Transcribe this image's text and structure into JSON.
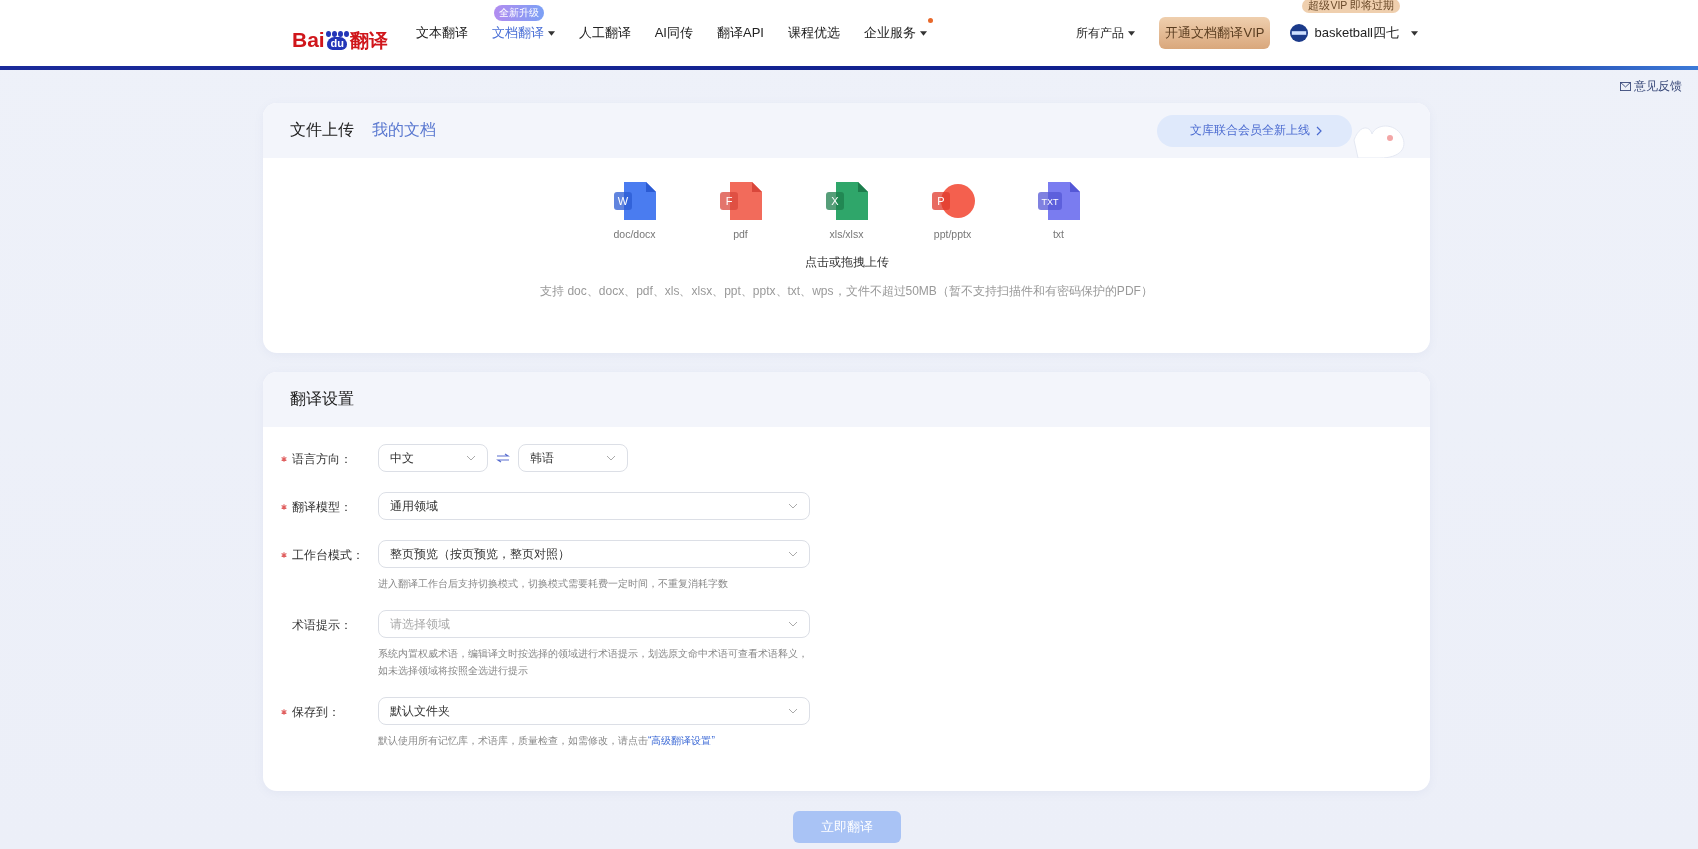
{
  "header": {
    "logo": {
      "latin": "Bai",
      "paw": "du",
      "cn": "翻译"
    },
    "nav": [
      {
        "label": "文本翻译",
        "selected": false,
        "has_menu": false,
        "has_dot": false
      },
      {
        "label": "文档翻译",
        "selected": true,
        "has_menu": true,
        "has_dot": false,
        "badge": "全新升级"
      },
      {
        "label": "人工翻译",
        "selected": false,
        "has_menu": false,
        "has_dot": false
      },
      {
        "label": "AI同传",
        "selected": false,
        "has_menu": false,
        "has_dot": false
      },
      {
        "label": "翻译API",
        "selected": false,
        "has_menu": false,
        "has_dot": false
      },
      {
        "label": "课程优选",
        "selected": false,
        "has_menu": false,
        "has_dot": false
      },
      {
        "label": "企业服务",
        "selected": false,
        "has_menu": true,
        "has_dot": true
      }
    ],
    "products": "所有产品",
    "vip_button": "开通文档翻译VIP",
    "user": {
      "name": "basketball四七",
      "badge": "超级VIP 即将过期"
    }
  },
  "feedback_link": "意见反馈",
  "upload_card": {
    "tabs": [
      {
        "label": "文件上传",
        "selected": true
      },
      {
        "label": "我的文档",
        "selected": false
      }
    ],
    "promo": "文库联合会员全新上线",
    "file_types": [
      {
        "kind": "word",
        "letter": "W",
        "label": "doc/docx"
      },
      {
        "kind": "pdf",
        "letter": "F",
        "label": "pdf"
      },
      {
        "kind": "excel",
        "letter": "X",
        "label": "xls/xlsx"
      },
      {
        "kind": "ppt",
        "letter": "P",
        "label": "ppt/pptx"
      },
      {
        "kind": "txt",
        "letter": "TXT",
        "label": "txt"
      }
    ],
    "prompt": "点击或拖拽上传",
    "hint": "支持 doc、docx、pdf、xls、xlsx、ppt、pptx、txt、wps，文件不超过50MB（暂不支持扫描件和有密码保护的PDF）"
  },
  "settings_card": {
    "title": "翻译设置",
    "fields": [
      {
        "kind": "language_pair",
        "label": "语言方向：",
        "required": true,
        "source": "中文",
        "target": "韩语"
      },
      {
        "kind": "select",
        "label": "翻译模型：",
        "required": true,
        "value": "通用领域"
      },
      {
        "kind": "select",
        "label": "工作台模式：",
        "required": true,
        "value": "整页预览（按页预览，整页对照）",
        "hint": "进入翻译工作台后支持切换模式，切换模式需要耗费一定时间，不重复消耗字数"
      },
      {
        "kind": "select",
        "label": "术语提示：",
        "required": false,
        "placeholder": "请选择领域",
        "hint": "系统内置权威术语，编辑译文时按选择的领域进行术语提示，划选原文命中术语可查看术语释义，如未选择领域将按照全选进行提示"
      },
      {
        "kind": "select",
        "label": "保存到：",
        "required": true,
        "value": "默认文件夹",
        "hint": "默认使用所有记忆库，术语库，质量检查，如需修改，请点击",
        "hint_link": "“高级翻译设置”"
      }
    ]
  },
  "submit_button": {
    "label": "立即翻译",
    "disabled": true
  }
}
